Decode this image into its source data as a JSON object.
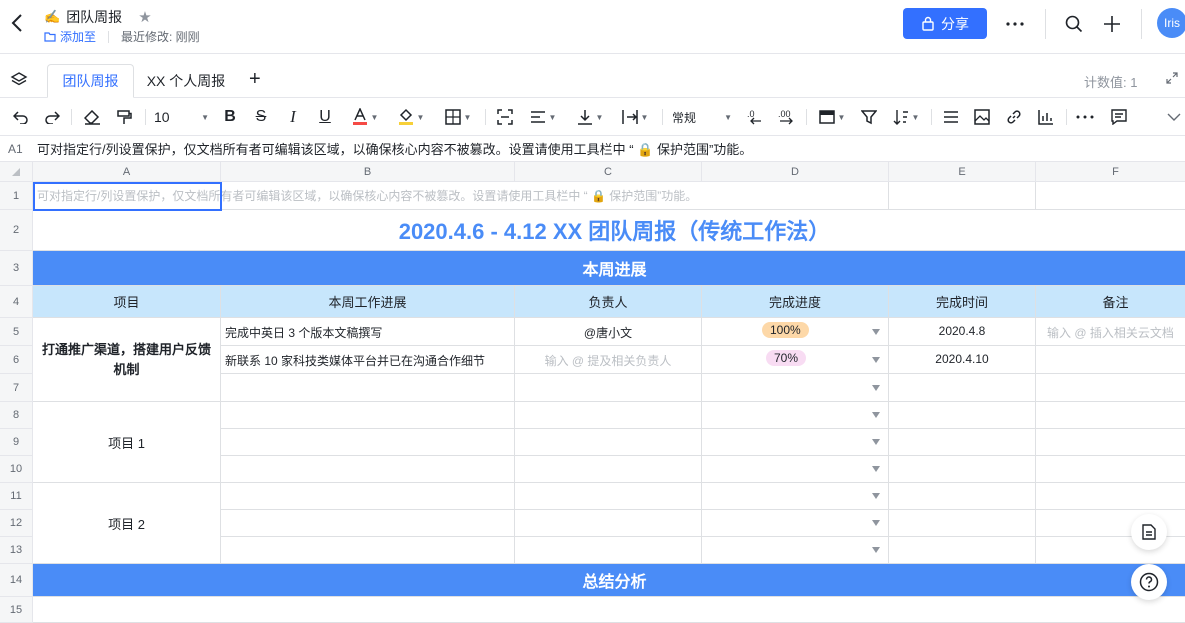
{
  "header": {
    "emoji": "✍️",
    "title": "团队周报",
    "add_to": "添加至",
    "last_modified": "最近修改: 刚刚",
    "share_label": "分享",
    "avatar_text": "Iris"
  },
  "tabs": {
    "items": [
      {
        "label": "团队周报"
      },
      {
        "label": "XX 个人周报"
      }
    ],
    "count": "计数值: 1"
  },
  "toolbar": {
    "font_size": "10",
    "number_format": "常规"
  },
  "formula_bar": {
    "cell_ref": "A1",
    "content": "可对指定行/列设置保护，仅文档所有者可编辑该区域，以确保核心内容不被篡改。设置请使用工具栏中 “ 🔒 保护范围”功能。"
  },
  "grid": {
    "columns": [
      "A",
      "B",
      "C",
      "D",
      "E",
      "F"
    ],
    "rows": [
      "1",
      "2",
      "3",
      "4",
      "5",
      "6",
      "7",
      "8",
      "9",
      "10",
      "11",
      "12",
      "13",
      "14",
      "15"
    ],
    "row1_text": "可对指定行/列设置保护，仅文档所有者可编辑该区域，以确保核心内容不被篡改。设置请使用工具栏中 “ 🔒 保护范围”功能。",
    "title": "2020.4.6 - 4.12 XX 团队周报（传统工作法）",
    "section_progress": "本周进展",
    "section_summary": "总结分析",
    "headers": [
      "项目",
      "本周工作进展",
      "负责人",
      "完成进度",
      "完成时间",
      "备注"
    ],
    "project_main": "打通推广渠道，搭建用户反馈机制",
    "project_1": "项目 1",
    "project_2": "项目 2",
    "rows_data": [
      {
        "work": "完成中英日 3 个版本文稿撰写",
        "owner": "@唐小文",
        "progress": "100%",
        "date": "2020.4.8",
        "note": "输入 @ 插入相关云文档"
      },
      {
        "work": "新联系 10 家科技类媒体平台并已在沟通合作细节",
        "owner": "输入 @ 提及相关负责人",
        "progress": "70%",
        "date": "2020.4.10",
        "note": ""
      }
    ]
  }
}
